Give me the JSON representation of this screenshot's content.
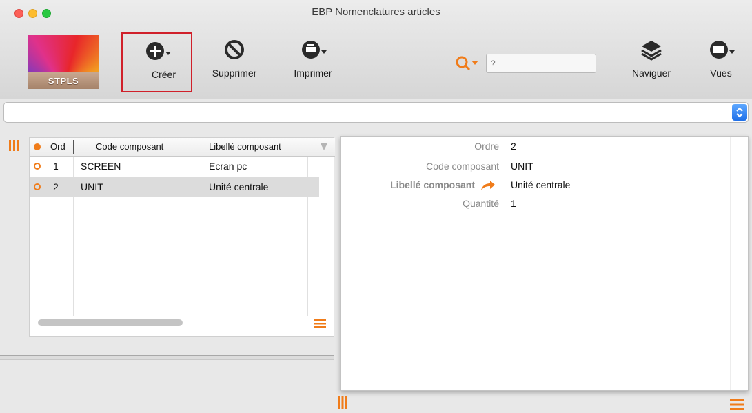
{
  "window": {
    "title": "EBP Nomenclatures articles"
  },
  "logo": {
    "text": "STPLS"
  },
  "toolbar": {
    "create_label": "Créer",
    "delete_label": "Supprimer",
    "print_label": "Imprimer",
    "navigate_label": "Naviguer",
    "views_label": "Vues"
  },
  "search": {
    "placeholder": "?"
  },
  "selector": {
    "value": ""
  },
  "grid": {
    "columns": [
      "Ord",
      "Code composant",
      "Libellé composant"
    ],
    "rows": [
      {
        "ord": "1",
        "code": "SCREEN",
        "label": "Ecran pc",
        "selected": false
      },
      {
        "ord": "2",
        "code": "UNIT",
        "label": "Unité centrale",
        "selected": true
      }
    ]
  },
  "detail": {
    "order_label": "Ordre",
    "order_value": "2",
    "code_label": "Code composant",
    "code_value": "UNIT",
    "libelle_label": "Libellé composant",
    "libelle_value": "Unité centrale",
    "quantity_label": "Quantité",
    "quantity_value": "1"
  },
  "colors": {
    "accent": "#f07c1a",
    "highlight_border": "#d0202a",
    "selection": "#dcdcdc"
  }
}
